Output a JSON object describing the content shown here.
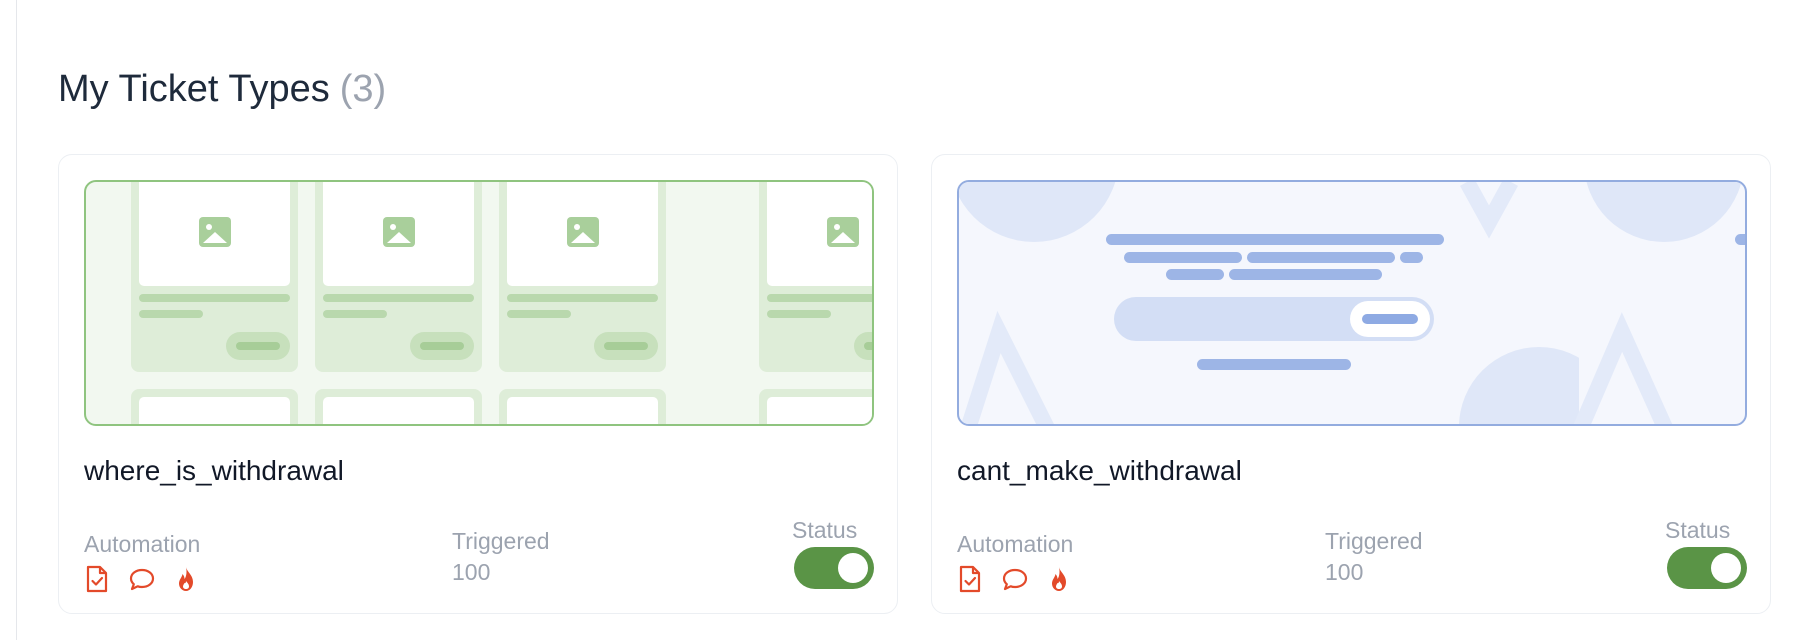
{
  "section": {
    "title": "My Ticket Types",
    "count": "(3)"
  },
  "labels": {
    "automation": "Automation",
    "triggered": "Triggered",
    "status": "Status"
  },
  "colors": {
    "accent_green": "#5a9446",
    "automation_icon": "#e34a2a",
    "green_preview": "#f2f8f0",
    "blue_preview": "#f5f7fd"
  },
  "cards": [
    {
      "name": "where_is_withdrawal",
      "triggered": "100",
      "status_enabled": true,
      "automation_icons": [
        "document-check-icon",
        "chat-bubble-icon",
        "flame-icon"
      ]
    },
    {
      "name": "cant_make_withdrawal",
      "triggered": "100",
      "status_enabled": true,
      "automation_icons": [
        "document-check-icon",
        "chat-bubble-icon",
        "flame-icon"
      ]
    }
  ]
}
